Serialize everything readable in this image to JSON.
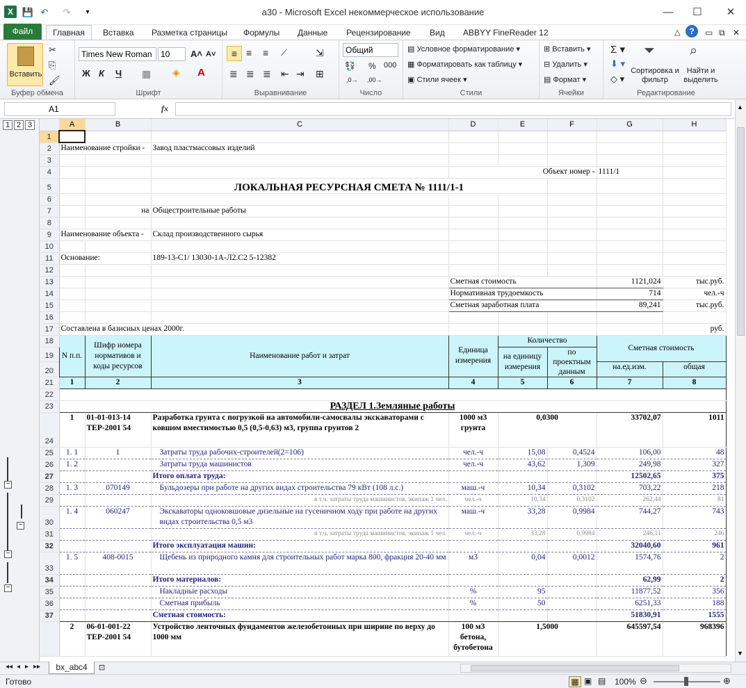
{
  "window": {
    "title": "a30 - Microsoft Excel некоммерческое использование"
  },
  "tabs": [
    "Файл",
    "Главная",
    "Вставка",
    "Разметка страницы",
    "Формулы",
    "Данные",
    "Рецензирование",
    "Вид",
    "ABBYY FineReader 12"
  ],
  "ribbon": {
    "paste": "Вставить",
    "font_name": "Times New Roman",
    "font_size": "10",
    "bold": "Ж",
    "italic": "К",
    "underline": "Ч",
    "number_format": "Общий",
    "cond_format": "Условное форматирование",
    "format_table": "Форматировать как таблицу",
    "cell_styles": "Стили ячеек",
    "insert": "Вставить",
    "delete": "Удалить",
    "format": "Формат",
    "sort": "Сортировка и фильтр",
    "find": "Найти и выделить",
    "groups": {
      "clipboard": "Буфер обмена",
      "font": "Шрифт",
      "align": "Выравнивание",
      "number": "Число",
      "styles": "Стили",
      "cells": "Ячейки",
      "edit": "Редактирование"
    }
  },
  "formula": {
    "namebox": "A1",
    "fx": "fx",
    "content": ""
  },
  "outline_levels": [
    "1",
    "2",
    "3"
  ],
  "columns": [
    "A",
    "B",
    "C",
    "D",
    "E",
    "F",
    "G",
    "H"
  ],
  "sheet": {
    "r2a": "Наименование стройки -",
    "r2c": "Завод пластмассовых изделий",
    "r4": "Объект номер -",
    "r4v": "1111/1",
    "r5": "ЛОКАЛЬНАЯ   РЕСУРСНАЯ   СМЕТА    № 1111/1-1",
    "r7a": "на",
    "r7c": "Общестроительные работы",
    "r9a": "Наименование объекта -",
    "r9c": "Склад производственного сырья",
    "r11a": "Основание:",
    "r11c": "189-13-С1/ 13030-1А-Л2.С2 5-12382",
    "r13": "Сметная стоимость",
    "r13v": "1121,024",
    "r13u": "тыс.руб.",
    "r14": "Нормативная трудоемкость",
    "r14v": "714",
    "r14u": "чел.-ч",
    "r15": "Сметная заработная плата",
    "r15v": "89,241",
    "r15u": "тыс.руб.",
    "r17": "Составлена в базисных ценах 2000г.",
    "r17u": "руб.",
    "h_np": "N п.п.",
    "h_code": "Шифр номера нормативов и коды ресурсов",
    "h_name": "Наименование работ и затрат",
    "h_unit": "Единица измерения",
    "h_qty": "Количество",
    "h_perunit": "на единицу измерения",
    "h_proj": "по проектным данным",
    "h_cost": "Сметная стоимость",
    "h_costunit": "на.ед.изм.",
    "h_total": "общая",
    "nums": [
      "1",
      "2",
      "3",
      "4",
      "5",
      "6",
      "7",
      "8"
    ],
    "section": "РАЗДЕЛ 1.Земляные работы",
    "rows": {
      "r24": {
        "n": "1",
        "code": "01-01-013-14 ТЕР-2001 54",
        "name": "Разработка грунта с погрузкой на автомобили-самосвалы экскаваторами с ковшом вместимостью 0,5 (0,5-0,63) м3, группа грунтов 2",
        "unit": "1000 м3 грунта",
        "e": "0,0300",
        "g": "33702,07",
        "h": "1011"
      },
      "r25": {
        "n": "1. 1",
        "code": "1",
        "name": "Затраты труда рабочих-строителей(2=106)",
        "unit": "чел.-ч",
        "e": "15,08",
        "f": "0,4524",
        "g": "106,00",
        "h": "48"
      },
      "r26": {
        "n": "1. 2",
        "name": "Затраты труда машинистов",
        "unit": "чел.-ч",
        "e": "43,62",
        "f": "1,309",
        "g": "249,98",
        "h": "327"
      },
      "r27": {
        "name": "Итого оплата труда:",
        "g": "12502,65",
        "h": "375"
      },
      "r28": {
        "n": "1. 3",
        "code": "070149",
        "name": "Бульдозеры при работе на других видах строительства 79 кВт (108 л.с.)",
        "unit": "маш.-ч",
        "e": "10,34",
        "f": "0,3102",
        "g": "703,22",
        "h": "218"
      },
      "r29": {
        "name": "в т.ч. затраты труда машинистов, экипаж 1 чел.",
        "unit": "чел.-ч",
        "e": "10,34",
        "f": "0,3102",
        "g": "262,44",
        "h": "81"
      },
      "r30": {
        "n": "1. 4",
        "code": "060247",
        "name": "Экскаваторы одноковшовые дизельные на гусеничном ходу при работе на других видах строительства 0,5 м3",
        "unit": "маш.-ч",
        "e": "33,28",
        "f": "0,9984",
        "g": "744,27",
        "h": "743"
      },
      "r31": {
        "name": "в т.ч. затраты труда машинистов, экипаж 1 чел.",
        "unit": "чел.-ч",
        "e": "33,28",
        "f": "0,9984",
        "g": "246,11",
        "h": "246"
      },
      "r32": {
        "name": "Итого эксплуатация машин:",
        "g": "32040,60",
        "h": "961"
      },
      "r33": {
        "n": "1. 5",
        "code": "408-0015",
        "name": "Щебень из природного камня для строительных работ марка 800, фракция 20-40 мм",
        "unit": "м3",
        "e": "0,04",
        "f": "0,0012",
        "g": "1574,76",
        "h": "2"
      },
      "r34": {
        "name": "Итого материалов:",
        "g": "62,99",
        "h": "2"
      },
      "r35": {
        "name": "Накладные расходы",
        "unit": "%",
        "e": "95",
        "g": "11877,52",
        "h": "356"
      },
      "r36": {
        "name": "Сметная прибыль",
        "unit": "%",
        "e": "50",
        "g": "6251,33",
        "h": "188"
      },
      "r37": {
        "name": "Сметная стоимость:",
        "g": "51830,91",
        "h": "1555"
      },
      "r38": {
        "n": "2",
        "code": "06-01-001-22 ТЕР-2001 54",
        "name": "Устройство ленточных фундаментов железобетонных при ширине по верху до 1000 мм",
        "unit": "100 м3 бетона, бутобетона",
        "e": "1,5000",
        "g": "645597,54",
        "h": "968396"
      }
    }
  },
  "sheet_tab": "bx_abc4",
  "status": {
    "ready": "Готово",
    "zoom": "100%"
  }
}
